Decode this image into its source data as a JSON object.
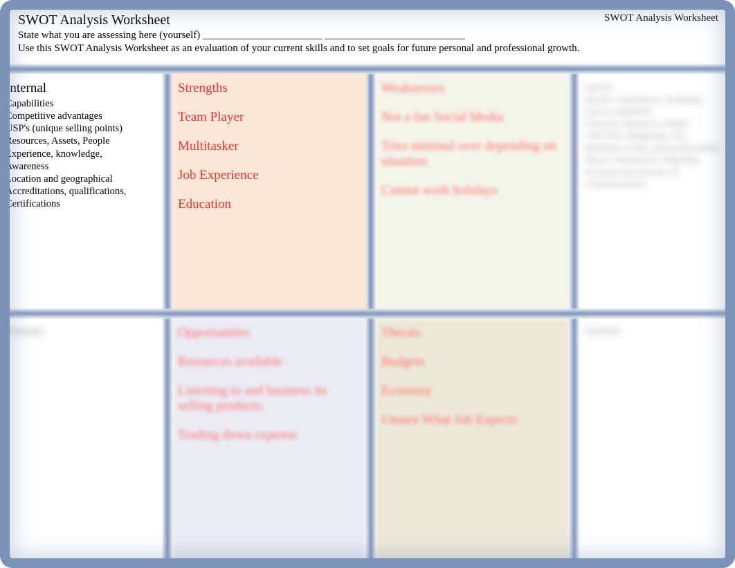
{
  "header": {
    "title": "SWOT Analysis Worksheet",
    "right": "SWOT Analysis Worksheet",
    "line1": "State what you are assessing here (yourself) _______________________ ___________________________",
    "line2": "Use this SWOT Analysis Worksheet as an evaluation of your current skills and to set goals for future personal and professional growth."
  },
  "internal": {
    "title": "Internal",
    "items": [
      "Capabilities",
      "Competitive advantages",
      "USP's (unique selling points)",
      "Resources, Assets, People",
      "Experience, knowledge,",
      " Awareness",
      "Location and geographical",
      "Accreditations, qualifications,",
      "Certifications"
    ]
  },
  "strengths": {
    "heading": "Strengths",
    "items": [
      "Team Player",
      "Multitasker",
      "Job Experience",
      "Education"
    ]
  },
  "weaknesses": {
    "heading": "Weaknesses",
    "items": [
      "Not a fan Social Media",
      "Tries minimal over depending on situation",
      "Cannot work holidays"
    ]
  },
  "right_top": {
    "title": "Internal",
    "lines": [
      "Morale, commitment, leadership",
      "Gap in capabilities",
      "Financial, Resources, People",
      "Cash Flow, Budgeting, Cost",
      "Reliability of data, plan predictability",
      "Moral, commitment, leadership",
      "Processes and systems, IT, Communications"
    ]
  },
  "external": {
    "title": "External"
  },
  "opportunities": {
    "heading": "Opportunities",
    "items": [
      "Resources available",
      "Listening to and business its selling products",
      "Trading down expense"
    ]
  },
  "threats": {
    "heading": "Threats",
    "items": [
      "Budgets",
      "Economy",
      "Unsure What Job Expects"
    ]
  },
  "right_bottom": {
    "title": "External"
  }
}
